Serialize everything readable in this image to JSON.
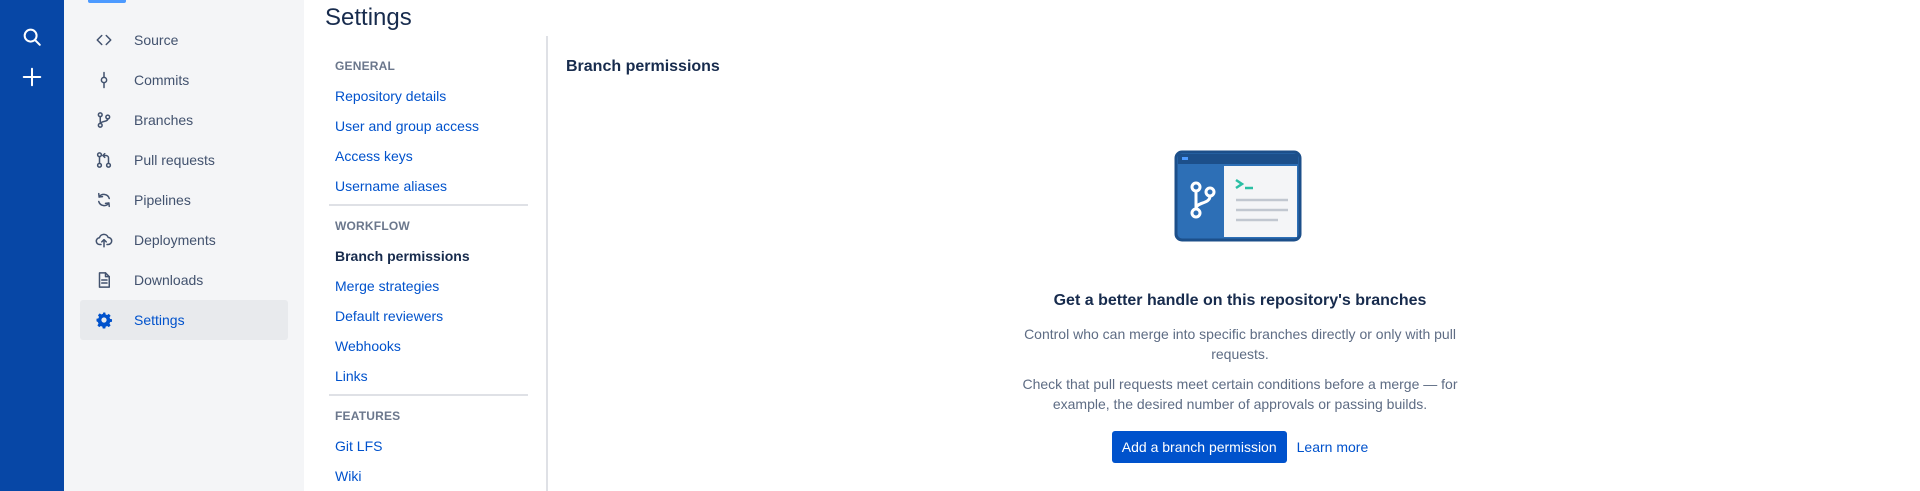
{
  "global_nav": {
    "icons": [
      {
        "name": "search-icon"
      },
      {
        "name": "plus-icon"
      }
    ]
  },
  "sidebar": {
    "items": [
      {
        "label": "Source",
        "icon": "source-code-icon",
        "active": false
      },
      {
        "label": "Commits",
        "icon": "commit-icon",
        "active": false
      },
      {
        "label": "Branches",
        "icon": "branch-icon",
        "active": false
      },
      {
        "label": "Pull requests",
        "icon": "pull-request-icon",
        "active": false
      },
      {
        "label": "Pipelines",
        "icon": "pipelines-icon",
        "active": false
      },
      {
        "label": "Deployments",
        "icon": "cloud-upload-icon",
        "active": false
      },
      {
        "label": "Downloads",
        "icon": "document-icon",
        "active": false
      },
      {
        "label": "Settings",
        "icon": "gear-icon",
        "active": true
      }
    ]
  },
  "page": {
    "title": "Settings"
  },
  "settings_nav": {
    "general_heading": "GENERAL",
    "general_links": [
      "Repository details",
      "User and group access",
      "Access keys",
      "Username aliases"
    ],
    "workflow_heading": "WORKFLOW",
    "workflow_links": [
      "Branch permissions",
      "Merge strategies",
      "Default reviewers",
      "Webhooks",
      "Links"
    ],
    "features_heading": "FEATURES",
    "features_links": [
      "Git LFS",
      "Wiki"
    ],
    "current": "Branch permissions"
  },
  "content": {
    "section_title": "Branch permissions",
    "empty_state": {
      "heading": "Get a better handle on this repository's branches",
      "paragraph_1": "Control who can merge into specific branches directly or only with pull requests.",
      "paragraph_2": "Check that pull requests meet certain conditions before a merge — for example, the desired number of approvals or passing builds.",
      "primary_button": "Add a branch permission",
      "secondary_link": "Learn more"
    }
  },
  "colors": {
    "global_nav": "#0747a6",
    "brand": "#0052cc",
    "sidebar_bg": "#f4f5f7"
  }
}
